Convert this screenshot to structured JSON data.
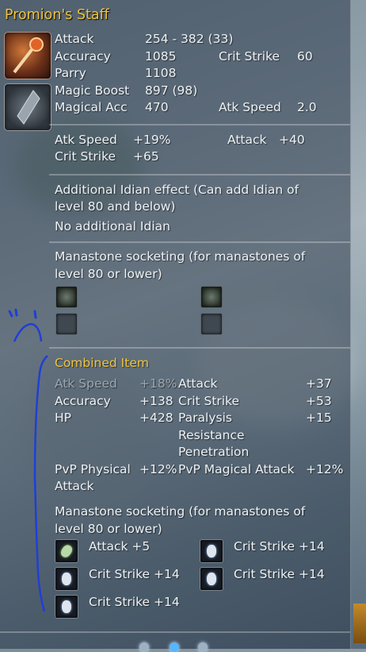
{
  "item": {
    "name": "Promion's Staff",
    "base_stats": {
      "attack_label": "Attack",
      "attack_value": "254 - 382 (33)",
      "accuracy_label": "Accuracy",
      "accuracy_value": "1085",
      "crit_label": "Crit Strike",
      "crit_value": "60",
      "parry_label": "Parry",
      "parry_value": "1108",
      "mboost_label": "Magic Boost",
      "mboost_value": "897 (98)",
      "macc_label": "Magical Acc",
      "macc_value": "470",
      "atkspd_label": "Atk Speed",
      "atkspd_value": "2.0"
    },
    "bonus_stats": {
      "atkspd_label": "Atk Speed",
      "atkspd_value": "+19%",
      "attack_label": "Attack",
      "attack_value": "+40",
      "crit_label": "Crit Strike",
      "crit_value": "+65"
    },
    "idian": {
      "heading": "Additional Idian effect (Can add Idian of level 80 and below)",
      "heading_line1": "Additional Idian effect (Can add Idian of",
      "heading_line2": "level 80 and below)",
      "status": "No additional Idian"
    },
    "manastone": {
      "heading_line1": "Manastone socketing (for manastones of",
      "heading_line2": "level 80 or lower)"
    },
    "combined": {
      "heading": "Combined Item",
      "stats": [
        {
          "label": "Atk Speed",
          "value": "+18%",
          "dim": true
        },
        {
          "label": "Attack",
          "value": "+37"
        },
        {
          "label": "Accuracy",
          "value": "+138"
        },
        {
          "label": "Crit Strike",
          "value": "+53"
        },
        {
          "label": "HP",
          "value": "+428"
        },
        {
          "label_line1": "Paralysis",
          "label_line2": "Resistance",
          "label_line3": "Penetration",
          "value": "+15"
        },
        {
          "label_line1": "PvP Physical",
          "label_line2": "Attack",
          "value": "+12%"
        },
        {
          "label": "PvP Magical Attack",
          "value": "+12%"
        }
      ],
      "manastone_heading_line1": "Manastone socketing (for manastones of",
      "manastone_heading_line2": "level 80 or lower)",
      "manastones": [
        {
          "label": "Attack +5",
          "icon": "manastone-attack-icon"
        },
        {
          "label": "Crit Strike +14",
          "icon": "manastone-crit-icon"
        },
        {
          "label": "Crit Strike +14",
          "icon": "manastone-crit-icon"
        },
        {
          "label": "Crit Strike +14",
          "icon": "manastone-crit-icon"
        },
        {
          "label": "Crit Strike +14",
          "icon": "manastone-crit-icon"
        }
      ]
    }
  },
  "colors": {
    "title": "#f0c43a",
    "text": "#eef2f5",
    "dim_text": "#9aa7b2",
    "annotation": "#1f3fd6"
  }
}
